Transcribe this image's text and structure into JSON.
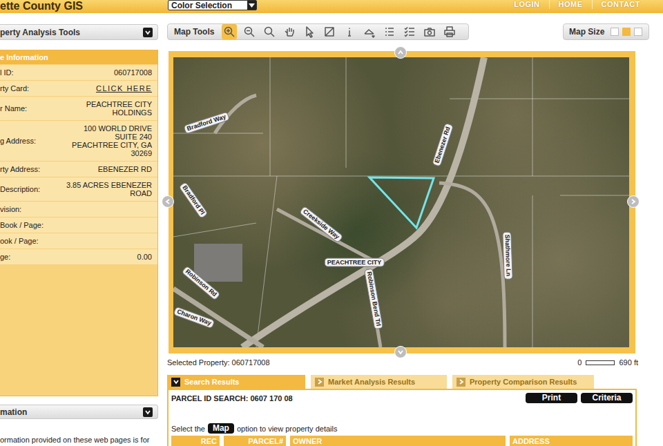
{
  "header": {
    "title": "ette County GIS",
    "links": [
      "LOGIN",
      "HOME",
      "CONTACT"
    ]
  },
  "color_select": {
    "value": "Color Selection"
  },
  "sidebar": {
    "tools_title": "perty Analysis Tools",
    "info_title": "e Information",
    "rows": [
      {
        "label": "l ID:",
        "lines": [
          "060717008"
        ],
        "kind": "text"
      },
      {
        "label": "rty Card:",
        "lines": [
          "CLICK HERE"
        ],
        "kind": "link"
      },
      {
        "label": "r Name:",
        "lines": [
          "PEACHTREE CITY",
          "HOLDINGS"
        ],
        "kind": "text"
      },
      {
        "label": "g Address:",
        "lines": [
          "100 WORLD DRIVE",
          "SUITE 240",
          "PEACHTREE CITY, GA",
          "30269"
        ],
        "kind": "text"
      },
      {
        "label": "rty Address:",
        "lines": [
          "EBENEZER RD"
        ],
        "kind": "text"
      },
      {
        "label": "Description:",
        "lines": [
          "3.85 ACRES EBENEZER",
          "ROAD"
        ],
        "kind": "text"
      },
      {
        "label": "vision:",
        "lines": [],
        "kind": "text"
      },
      {
        "label": "Book / Page:",
        "lines": [],
        "kind": "text"
      },
      {
        "label": "ook / Page:",
        "lines": [],
        "kind": "text"
      },
      {
        "label": "ge:",
        "lines": [
          "0.00"
        ],
        "kind": "text"
      }
    ],
    "section_title": "mation",
    "note": "ormation provided on these web pages is for"
  },
  "toolbar": {
    "title": "Map Tools",
    "tools": [
      {
        "selected": true
      },
      {
        "selected": false
      },
      {
        "selected": false
      },
      {
        "selected": false
      },
      {
        "selected": false
      },
      {
        "selected": false
      },
      {
        "selected": false
      },
      {
        "selected": false
      },
      {
        "selected": false
      },
      {
        "selected": false
      },
      {
        "selected": false
      },
      {
        "selected": false
      }
    ],
    "size_label": "Map Size",
    "sizes": [
      {
        "selected": false
      },
      {
        "selected": true
      },
      {
        "selected": false
      }
    ]
  },
  "map": {
    "labels": [
      "Bradford Way",
      "Bradford Pl",
      "Creekside Way",
      "PEACHTREE CITY",
      "Robinson Rd",
      "Robinson Bend Trl",
      "Charon Way",
      "Ebenezer Rd",
      "Shathmore Ln"
    ]
  },
  "selected_property": "Selected Property: 060717008",
  "scale": {
    "start": "0",
    "end": "690 ft"
  },
  "tabs": [
    {
      "label": "Search Results",
      "selected": true
    },
    {
      "label": "Market Analysis Results",
      "selected": false
    },
    {
      "label": "Property Comparison Results",
      "selected": false
    }
  ],
  "results": {
    "title": "PARCEL ID SEARCH: 0607 170 08",
    "buttons": [
      "Print",
      "Criteria"
    ],
    "hint_before": "Select the",
    "hint_button": "Map",
    "hint_after": "option to view property details",
    "columns": [
      "REC",
      "PARCEL#",
      "OWNER",
      "ADDRESS"
    ]
  }
}
